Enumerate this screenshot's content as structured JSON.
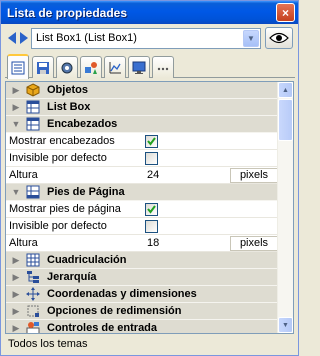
{
  "window": {
    "title": "Lista de propiedades",
    "close_label": "×"
  },
  "selector": {
    "value": "List Box1 (List Box1)"
  },
  "tabs": [
    {
      "icon": "property-list-icon",
      "active": true
    },
    {
      "icon": "disk-icon"
    },
    {
      "icon": "gear-icon"
    },
    {
      "icon": "shapes-icon"
    },
    {
      "icon": "graph-icon"
    },
    {
      "icon": "monitor-icon"
    },
    {
      "icon": "more-icon"
    }
  ],
  "grid": {
    "categories": {
      "objetos": "Objetos",
      "list_box": "List Box",
      "encabezados": "Encabezados",
      "pies": "Pies de Página",
      "cuadriculacion": "Cuadriculación",
      "jerarquia": "Jerarquía",
      "coordenadas": "Coordenadas y dimensiones",
      "redimension": "Opciones de redimensión",
      "controles": "Controles de entrada"
    },
    "encabezados_props": {
      "mostrar_label": "Mostrar encabezados",
      "mostrar_checked": true,
      "invisible_label": "Invisible por defecto",
      "invisible_checked": false,
      "altura_label": "Altura",
      "altura_value": "24",
      "altura_unit": "pixels"
    },
    "pies_props": {
      "mostrar_label": "Mostrar pies de página",
      "mostrar_checked": true,
      "invisible_label": "Invisible por defecto",
      "invisible_checked": false,
      "altura_label": "Altura",
      "altura_value": "18",
      "altura_unit": "pixels"
    }
  },
  "statusbar": {
    "text": "Todos los temas"
  },
  "colors": {
    "titlebar": "#0058e6",
    "category_bg": "#dedcd1",
    "check_color": "#21a121"
  }
}
